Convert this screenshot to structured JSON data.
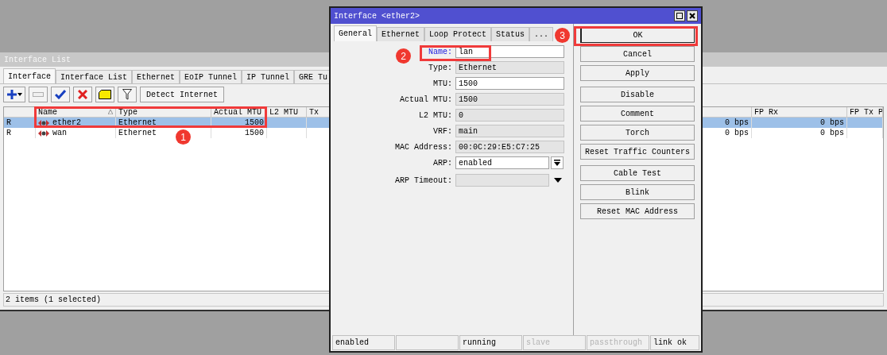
{
  "interface_list": {
    "title": "Interface List",
    "tabs": [
      {
        "label": "Interface",
        "selected": true
      },
      {
        "label": "Interface List",
        "selected": false
      },
      {
        "label": "Ethernet",
        "selected": false
      },
      {
        "label": "EoIP Tunnel",
        "selected": false
      },
      {
        "label": "IP Tunnel",
        "selected": false
      },
      {
        "label": "GRE Tu",
        "selected": false
      }
    ],
    "toolbar": {
      "detect_button": "Detect Internet"
    },
    "table": {
      "columns": [
        {
          "label": "Name",
          "sorted": true
        },
        {
          "label": "Type"
        },
        {
          "label": "Actual MTU"
        },
        {
          "label": "L2 MTU"
        },
        {
          "label": "Tx"
        },
        {
          "label": "FP Rx"
        },
        {
          "label": "FP Tx P"
        }
      ],
      "rows": [
        {
          "selected": true,
          "flag": "R",
          "name": "ether2",
          "type": "Ethernet",
          "actual_mtu": "1500",
          "tx": "0 bps",
          "fp_rx": "0 bps"
        },
        {
          "selected": false,
          "flag": "R",
          "name": "wan",
          "type": "Ethernet",
          "actual_mtu": "1500",
          "tx": "0 bps",
          "fp_rx": "0 bps"
        }
      ]
    },
    "status": "2 items (1 selected)"
  },
  "dialog": {
    "title": "Interface <ether2>",
    "tabs": [
      {
        "label": "General",
        "selected": true
      },
      {
        "label": "Ethernet",
        "selected": false
      },
      {
        "label": "Loop Protect",
        "selected": false
      },
      {
        "label": "Status",
        "selected": false
      },
      {
        "label": "...",
        "selected": false
      }
    ],
    "fields": [
      {
        "kind": "text",
        "label": "Name:",
        "value": "lan",
        "editable": true,
        "focused": true
      },
      {
        "kind": "text",
        "label": "Type:",
        "value": "Ethernet",
        "editable": false,
        "focused": false
      },
      {
        "kind": "text",
        "label": "MTU:",
        "value": "1500",
        "editable": true,
        "focused": false
      },
      {
        "kind": "text",
        "label": "Actual MTU:",
        "value": "1500",
        "editable": false,
        "focused": false
      },
      {
        "kind": "text",
        "label": "L2 MTU:",
        "value": "0",
        "editable": false,
        "focused": false
      },
      {
        "kind": "text",
        "label": "VRF:",
        "value": "main",
        "editable": false,
        "focused": false
      },
      {
        "kind": "text",
        "label": "MAC Address:",
        "value": "00:0C:29:E5:C7:25",
        "editable": false,
        "focused": false
      },
      {
        "kind": "select",
        "label": "ARP:",
        "value": "enabled",
        "editable": true,
        "focused": false
      },
      {
        "kind": "combo",
        "label": "ARP Timeout:",
        "editable": false,
        "focused": false
      }
    ],
    "button_groups": [
      [
        {
          "label": "OK",
          "default": true
        },
        {
          "label": "Cancel",
          "default": false
        },
        {
          "label": "Apply",
          "default": false
        }
      ],
      [
        {
          "label": "Disable",
          "default": false
        },
        {
          "label": "Comment",
          "default": false
        },
        {
          "label": "Torch",
          "default": false
        },
        {
          "label": "Reset Traffic Counters",
          "default": false
        }
      ],
      [
        {
          "label": "Cable Test",
          "default": false
        },
        {
          "label": "Blink",
          "default": false
        },
        {
          "label": "Reset MAC Address",
          "default": false
        }
      ]
    ],
    "status_cells": [
      {
        "text": "enabled",
        "disabled": false
      },
      {},
      {
        "text": "running",
        "disabled": false
      },
      {
        "text": "slave",
        "disabled": true
      },
      {
        "text": "passthrough",
        "disabled": true
      },
      {
        "text": "link ok",
        "disabled": false
      }
    ]
  },
  "annotations": [
    {
      "number": "1"
    },
    {
      "number": "2"
    },
    {
      "number": "3"
    }
  ]
}
